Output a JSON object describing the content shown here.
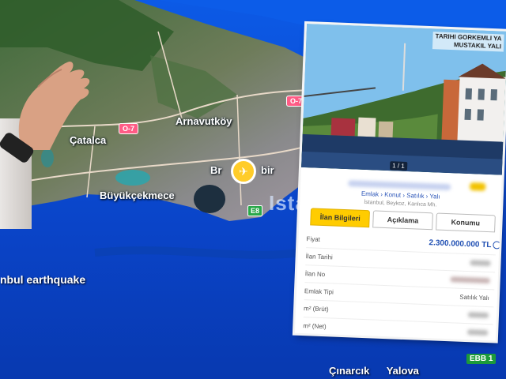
{
  "map": {
    "places": {
      "catalca": "Çatalca",
      "arnavutkoy": "Arnavutköy",
      "buyukcekmece": "Büyükçekmece",
      "istanbul_partial": "Ista",
      "airport_partial": "Br",
      "airport_partial2": "bir",
      "cinarcik": "Çınarcık",
      "yalova": "Yalova"
    },
    "roads": {
      "o7_a": "O-7",
      "o7_b": "O-7",
      "e80": "E8"
    },
    "caption": "nbul earthquake",
    "channel_badge": "EBB 1",
    "sea_color": "#0b4bd4"
  },
  "listing": {
    "photo_title_line1": "TARIHI GORKEMLI YA",
    "photo_title_line2": "MUSTAKIL YALI",
    "photo_counter": "1 / 1",
    "breadcrumb": "Emlak › Konut › Satılık › Yalı",
    "location": "İstanbul, Beykoz, Kanlıca Mh.",
    "tabs": [
      {
        "label": "İlan Bilgileri",
        "active": true
      },
      {
        "label": "Açıklama",
        "active": false
      },
      {
        "label": "Konumu",
        "active": false
      }
    ],
    "rows": {
      "price_label": "Fiyat",
      "price_value": "2.300.000.000 TL",
      "date_label": "İlan Tarihi",
      "no_label": "İlan No",
      "type_label": "Emlak Tipi",
      "type_value": "Satılık Yalı",
      "gross_label": "m² (Brüt)",
      "net_label": "m² (Net)"
    },
    "accent_color": "#ffcc00",
    "link_color": "#1f4fb3"
  }
}
